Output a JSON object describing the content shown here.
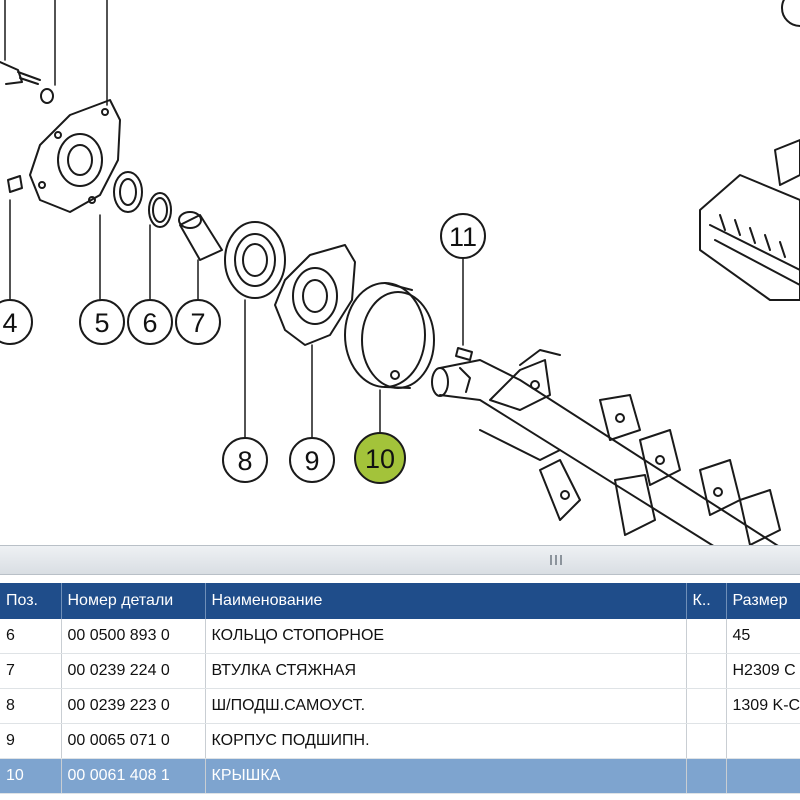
{
  "diagram": {
    "callouts": [
      {
        "id": "4",
        "label": "4"
      },
      {
        "id": "5",
        "label": "5"
      },
      {
        "id": "6",
        "label": "6"
      },
      {
        "id": "7",
        "label": "7"
      },
      {
        "id": "8",
        "label": "8"
      },
      {
        "id": "9",
        "label": "9"
      },
      {
        "id": "10",
        "label": "10",
        "highlighted": true
      },
      {
        "id": "11",
        "label": "11"
      }
    ],
    "colors": {
      "highlight": "#a3c33a",
      "line": "#1a1a1a"
    }
  },
  "table": {
    "columns": [
      "Поз.",
      "Номер детали",
      "Наименование",
      "К..",
      "Размер"
    ],
    "rows": [
      {
        "pos": "6",
        "part_no": "00 0500 893 0",
        "name": "КОЛЬЦО СТОПОРНОЕ",
        "qty": "",
        "size": "45"
      },
      {
        "pos": "7",
        "part_no": "00 0239 224 0",
        "name": "ВТУЛКА СТЯЖНАЯ",
        "qty": "",
        "size": "H2309 C"
      },
      {
        "pos": "8",
        "part_no": "00 0239 223 0",
        "name": "Ш/ПОДШ.САМОУСТ.",
        "qty": "",
        "size": "1309 K-C"
      },
      {
        "pos": "9",
        "part_no": "00 0065 071 0",
        "name": "КОРПУС ПОДШИПН.",
        "qty": "",
        "size": ""
      },
      {
        "pos": "10",
        "part_no": "00 0061 408 1",
        "name": "КРЫШКА",
        "qty": "",
        "size": "",
        "selected": true
      }
    ],
    "colors": {
      "header": "#1f4d8a",
      "selected": "#7ea4cf"
    }
  }
}
